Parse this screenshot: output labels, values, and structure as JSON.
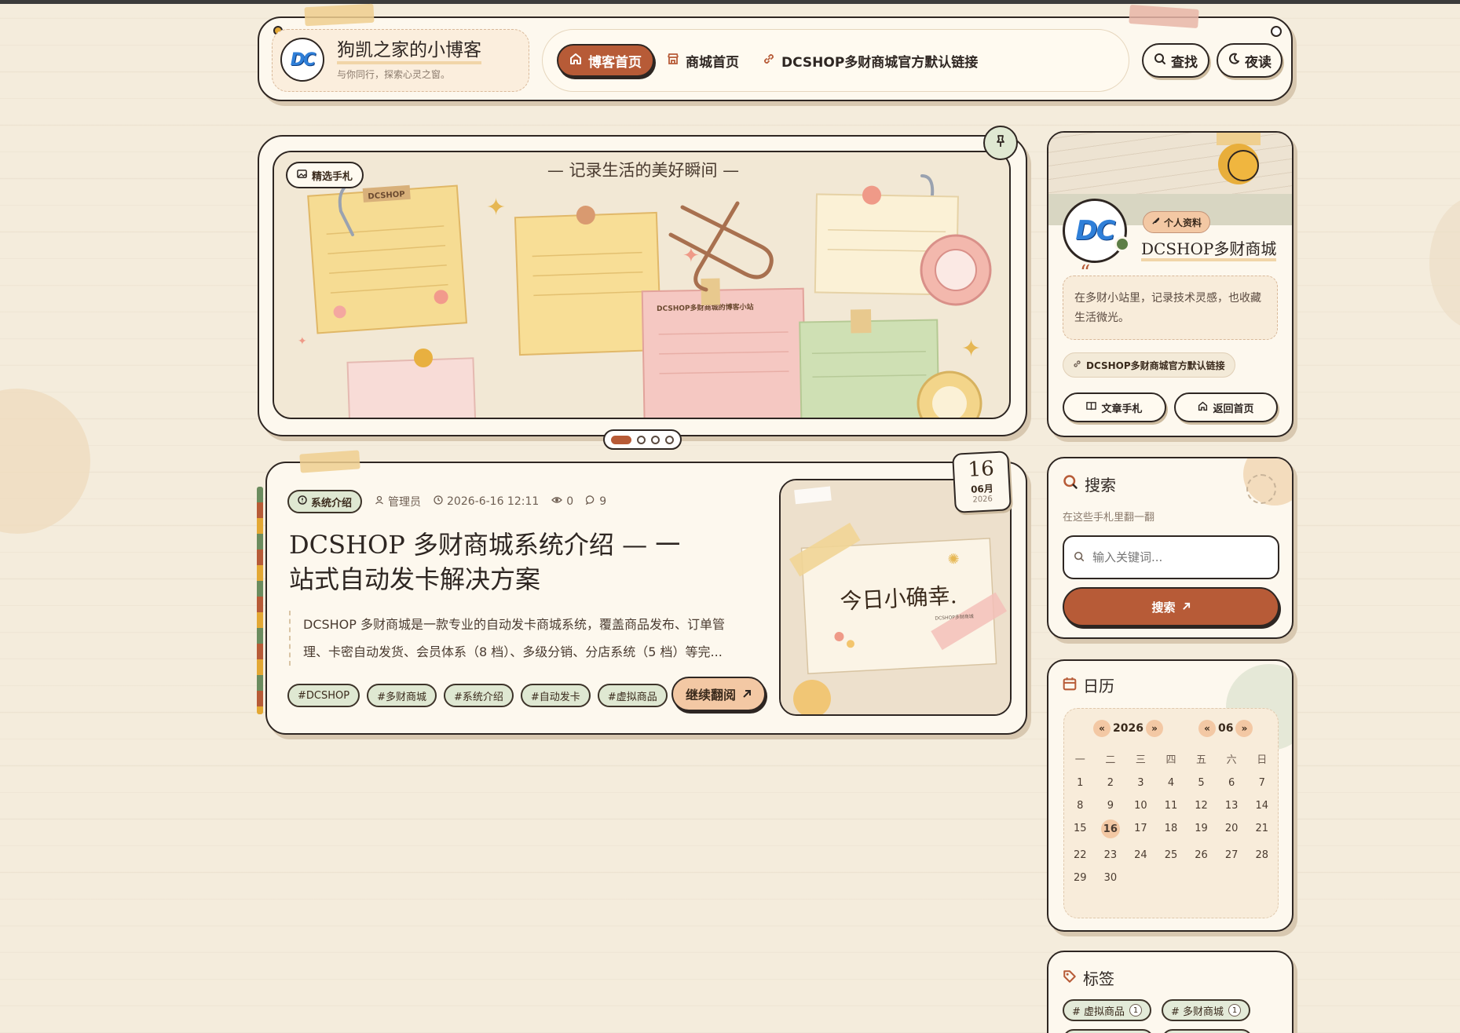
{
  "header": {
    "site_title": "狗凯之家的小博客",
    "tagline": "与你同行，探索心灵之窗。",
    "nav": [
      {
        "label": "博客首页",
        "icon": "home-icon",
        "active": true
      },
      {
        "label": "商城首页",
        "icon": "store-icon",
        "active": false
      },
      {
        "label": "DCSHOP多财商城官方默认链接",
        "icon": "link-icon",
        "active": false
      }
    ],
    "search_label": "查找",
    "night_label": "夜读"
  },
  "slider": {
    "badge": "精选手札",
    "banner_text": "— 记录生活的美好瞬间 —",
    "note_label_1": "DCSHOP",
    "note_label_2": "DCSHOP多财商城的博客小站",
    "dots": 4,
    "active_dot": 0
  },
  "post": {
    "category": "系统介绍",
    "author": "管理员",
    "datetime": "2026-6-16 12:11",
    "views": "0",
    "comments": "9",
    "title_line1": "DCSHOP 多财商城系统介绍 — 一",
    "title_line2": "站式自动发卡解决方案",
    "excerpt_line1": "DCSHOP 多财商城是一款专业的自动发卡商城系统，覆盖商品发布、订单管",
    "excerpt_line2": "理、卡密自动发货、会员体系（8 档）、多级分销、分店系统（5 档）等完...",
    "tags": [
      "#DCSHOP",
      "#多财商城",
      "#系统介绍",
      "#自动发卡",
      "#虚拟商品"
    ],
    "read_more": "继续翻阅",
    "date_day": "16",
    "date_month": "06月",
    "date_year": "2026",
    "thumb_text": "今日小确幸.",
    "thumb_small": "DCSHOP多财商城"
  },
  "profile": {
    "badge": "个人资料",
    "name": "DCSHOP多财商城",
    "quote_mark": "“",
    "bio_line1": "在多财小站里，记录技术灵感，也收藏",
    "bio_line2": "生活微光。",
    "link_label": "DCSHOP多财商城官方默认链接",
    "btn_articles": "文章手札",
    "btn_home": "返回首页"
  },
  "search_widget": {
    "title": "搜索",
    "subtitle": "在这些手札里翻一翻",
    "placeholder": "输入关键词...",
    "button": "搜索"
  },
  "calendar": {
    "title": "日历",
    "prev": "«",
    "next": "»",
    "year": "2026",
    "month": "06",
    "weekdays": [
      "一",
      "二",
      "三",
      "四",
      "五",
      "六",
      "日"
    ],
    "days": [
      "1",
      "2",
      "3",
      "4",
      "5",
      "6",
      "7",
      "8",
      "9",
      "10",
      "11",
      "12",
      "13",
      "14",
      "15",
      "16",
      "17",
      "18",
      "19",
      "20",
      "21",
      "22",
      "23",
      "24",
      "25",
      "26",
      "27",
      "28",
      "29",
      "30"
    ],
    "today": "16"
  },
  "tags_widget": {
    "title": "标签",
    "tags": [
      {
        "name": "虚拟商品",
        "count": "1"
      },
      {
        "name": "多财商城",
        "count": "1"
      }
    ]
  },
  "colors": {
    "accent": "#b75b37",
    "background": "#f4ecdc",
    "card": "#fdf8ee",
    "ink": "#2e2622",
    "sage": "#dfe8d2",
    "peach": "#f3c8a4"
  }
}
